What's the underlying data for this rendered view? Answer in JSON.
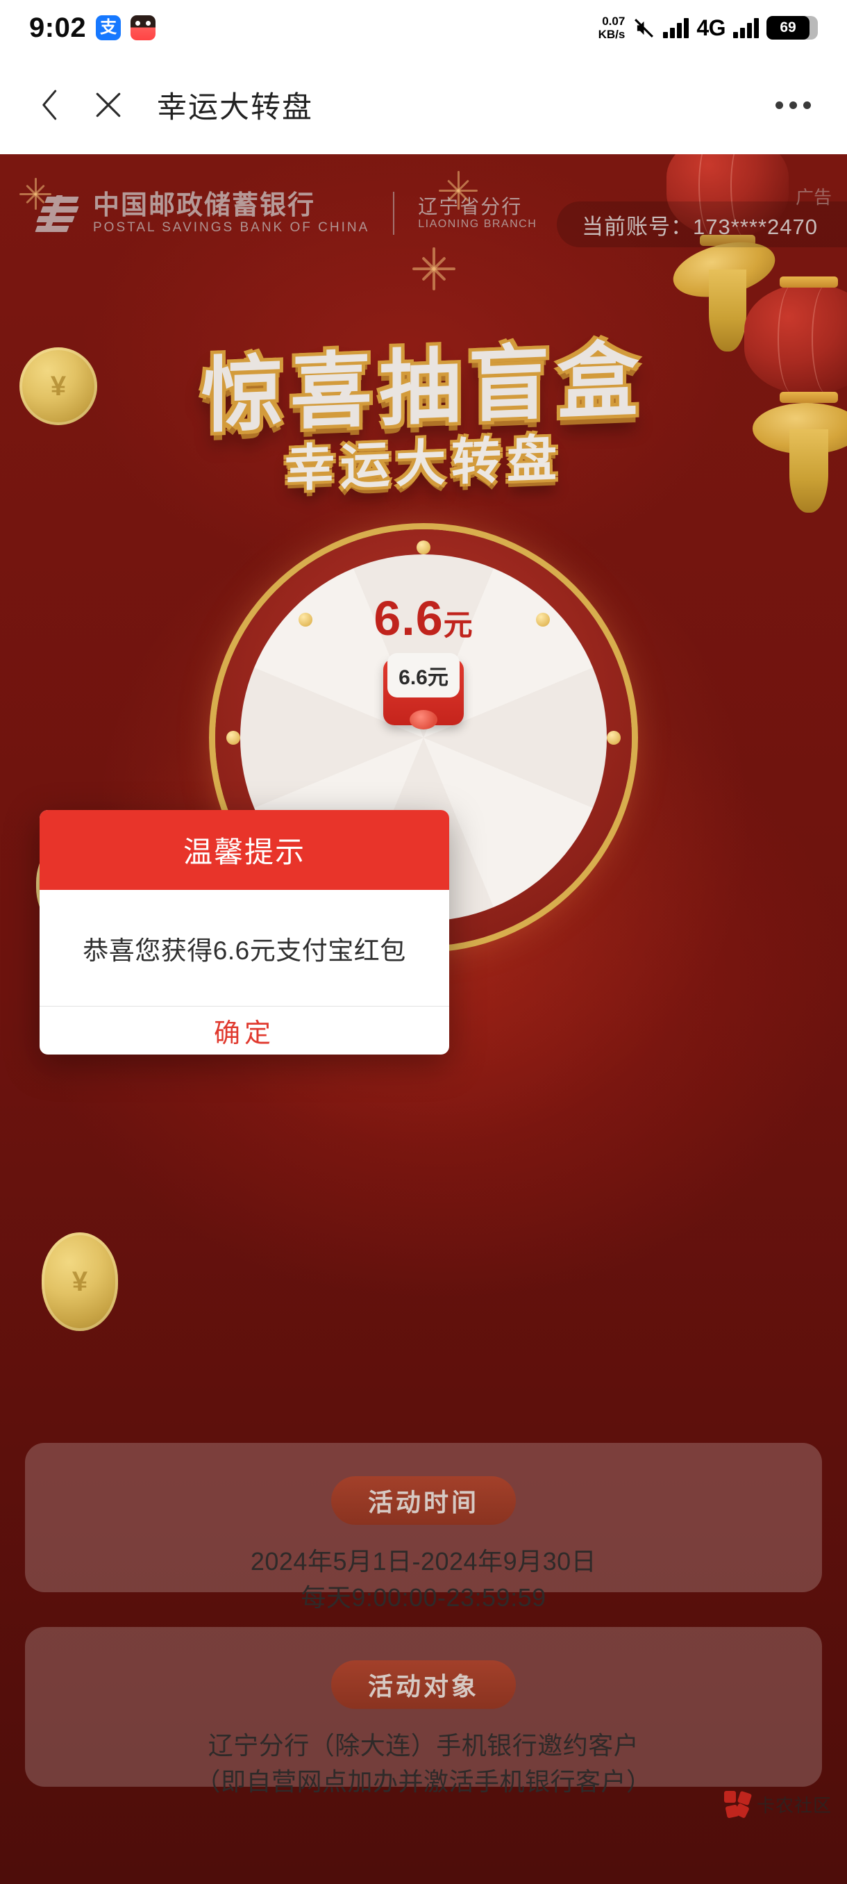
{
  "statusbar": {
    "time": "9:02",
    "alipay_glyph": "支",
    "net_speed_value": "0.07",
    "net_speed_unit": "KB/s",
    "network_type": "4G",
    "battery_level": "69"
  },
  "navbar": {
    "title": "幸运大转盘",
    "back_icon": "chevron-left-icon",
    "close_icon": "close-icon",
    "more_icon": "more-dots-icon"
  },
  "banner": {
    "bank_name_cn": "中国邮政储蓄银行",
    "bank_name_en": "POSTAL SAVINGS BANK OF CHINA",
    "branch_cn": "辽宁省分行",
    "branch_en": "LIAONING BRANCH",
    "account_label": "当前账号：173****2470",
    "ad_label": "广告",
    "hero_title_1": "惊喜抽盲盒",
    "hero_title_2": "幸运大转盘"
  },
  "wheel": {
    "prize_amount": "6.6",
    "prize_unit": "元",
    "envelope_label": "6.6元"
  },
  "dialog": {
    "title": "温馨提示",
    "message": "恭喜您获得6.6元支付宝红包",
    "confirm_label": "确定",
    "header_color": "#e8342a",
    "confirm_color": "#e0392e"
  },
  "cards": [
    {
      "pill": "活动时间",
      "lines": [
        "2024年5月1日-2024年9月30日",
        "每天9:00:00-23:59:59"
      ]
    },
    {
      "pill": "活动对象",
      "lines": [
        "辽宁分行（除大连）手机银行邀约客户",
        "（即自营网点加办并激活手机银行客户）"
      ]
    }
  ],
  "watermark": {
    "text": "卡农社区"
  }
}
